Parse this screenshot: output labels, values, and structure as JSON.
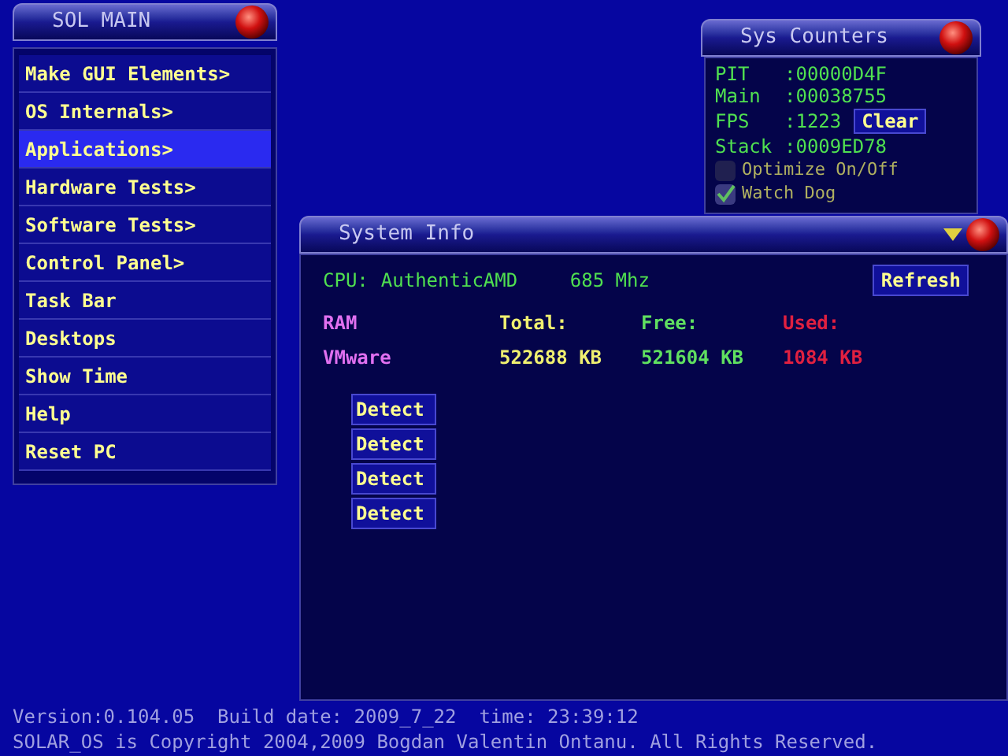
{
  "main_menu": {
    "title": "SOL MAIN",
    "items": [
      {
        "label": "Make GUI Elements>",
        "selected": false
      },
      {
        "label": "OS Internals>",
        "selected": false
      },
      {
        "label": "Applications>",
        "selected": true
      },
      {
        "label": "Hardware Tests>",
        "selected": false
      },
      {
        "label": "Software Tests>",
        "selected": false
      },
      {
        "label": "Control Panel>",
        "selected": false
      },
      {
        "label": "Task Bar",
        "selected": false
      },
      {
        "label": "Desktops",
        "selected": false
      },
      {
        "label": "Show Time",
        "selected": false
      },
      {
        "label": "Help",
        "selected": false
      },
      {
        "label": "Reset PC",
        "selected": false
      }
    ]
  },
  "sys_counters": {
    "title": "Sys Counters",
    "rows": [
      {
        "label": "PIT",
        "value": ":00000D4F"
      },
      {
        "label": "Main",
        "value": ":00038755"
      },
      {
        "label": "FPS",
        "value": ":1223",
        "button": "Clear"
      },
      {
        "label": "Stack",
        "value": ":0009ED78"
      }
    ],
    "options": [
      {
        "label": "Optimize On/Off",
        "checked": false
      },
      {
        "label": "Watch Dog",
        "checked": true
      }
    ]
  },
  "system_info": {
    "title": "System Info",
    "cpu_label": "CPU:",
    "cpu": "AuthenticAMD",
    "speed": "685 Mhz",
    "refresh_button": "Refresh",
    "ram_columns": [
      {
        "header": "RAM",
        "value": "VMware",
        "color": "#e070f0"
      },
      {
        "header": "Total:",
        "value": "522688 KB",
        "color": "#f0f070"
      },
      {
        "header": "Free:",
        "value": "521604 KB",
        "color": "#60e060"
      },
      {
        "header": "Used:",
        "value": "1084 KB",
        "color": "#e02040"
      }
    ],
    "detect_buttons": [
      "Detect",
      "Detect",
      "Detect",
      "Detect"
    ]
  },
  "footer": [
    "Version:0.104.05  Build date: 2009_7_22  time: 23:39:12",
    "SOLAR_OS is Copyright 2004,2009 Bogdan Valentin Ontanu. All Rights Reserved."
  ]
}
